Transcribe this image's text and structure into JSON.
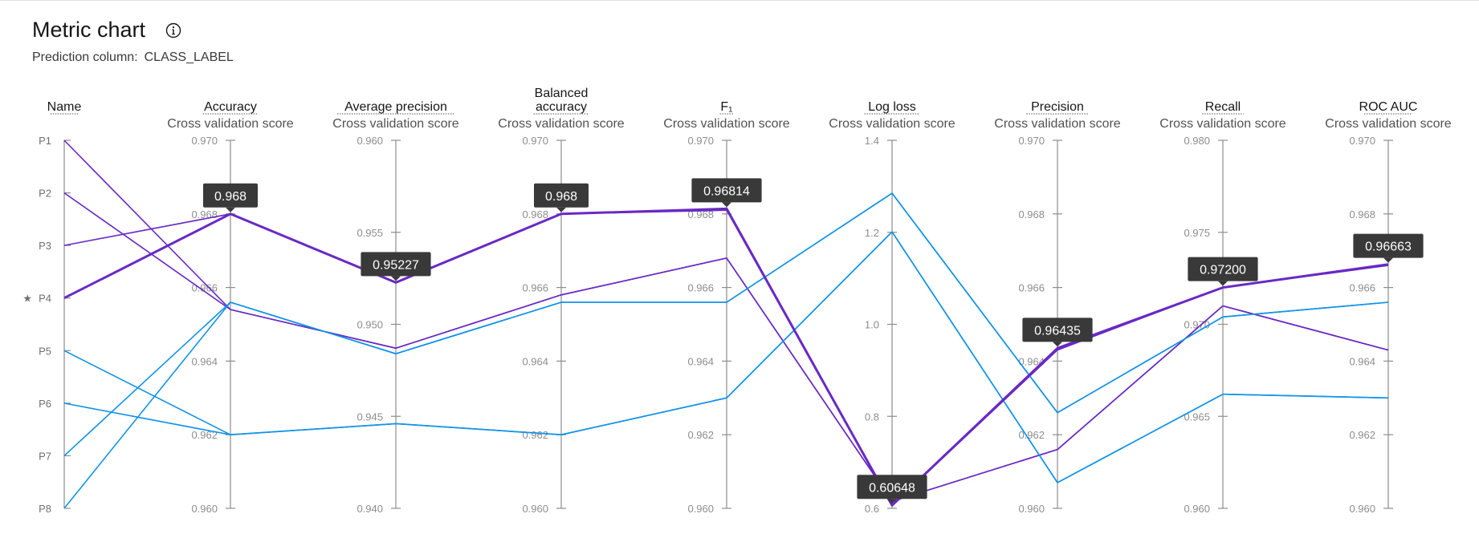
{
  "header": {
    "title": "Metric chart",
    "prediction_label": "Prediction column:",
    "prediction_value": "CLASS_LABEL"
  },
  "colors": {
    "purple": "#6929c4",
    "blue": "#1192e8",
    "axis": "#8d8d8d",
    "tooltip_bg": "#393939"
  },
  "icons": {
    "info": "info-icon"
  },
  "chart_data": {
    "type": "parallel-coordinates",
    "name_axis": {
      "label": "Name",
      "ticks": [
        "P1",
        "P2",
        "P3",
        "P4",
        "P5",
        "P6",
        "P7",
        "P8"
      ],
      "starred": "P4",
      "star_glyph": "★"
    },
    "axes": [
      {
        "key": "accuracy",
        "label": "Accuracy",
        "sublabel": "Cross validation score",
        "range": [
          0.96,
          0.97
        ],
        "ticks": [
          "0.970",
          "0.968",
          "0.966",
          "0.964",
          "0.962",
          "0.960"
        ]
      },
      {
        "key": "avg_precision",
        "label": "Average precision",
        "sublabel": "Cross validation score",
        "range": [
          0.94,
          0.96
        ],
        "ticks": [
          "0.960",
          "0.955",
          "0.950",
          "0.945",
          "0.940"
        ]
      },
      {
        "key": "balanced_accuracy",
        "label": "Balanced",
        "label2": "accuracy",
        "sublabel": "Cross validation score",
        "range": [
          0.96,
          0.97
        ],
        "ticks": [
          "0.970",
          "0.968",
          "0.966",
          "0.964",
          "0.962",
          "0.960"
        ]
      },
      {
        "key": "f1",
        "label": "F₁",
        "sublabel": "Cross validation score",
        "range": [
          0.96,
          0.97
        ],
        "ticks": [
          "0.970",
          "0.968",
          "0.966",
          "0.964",
          "0.962",
          "0.960"
        ]
      },
      {
        "key": "log_loss",
        "label": "Log loss",
        "sublabel": "Cross validation score",
        "range": [
          0.6,
          1.4
        ],
        "ticks": [
          "1.4",
          "1.2",
          "1.0",
          "0.8",
          "0.6"
        ]
      },
      {
        "key": "precision",
        "label": "Precision",
        "sublabel": "Cross validation score",
        "range": [
          0.96,
          0.97
        ],
        "ticks": [
          "0.970",
          "0.968",
          "0.966",
          "0.964",
          "0.962",
          "0.960"
        ]
      },
      {
        "key": "recall",
        "label": "Recall",
        "sublabel": "Cross validation score",
        "range": [
          0.96,
          0.98
        ],
        "ticks": [
          "0.980",
          "0.975",
          "0.970",
          "0.965",
          "0.960"
        ]
      },
      {
        "key": "roc_auc",
        "label": "ROC AUC",
        "sublabel": "Cross validation score",
        "range": [
          0.96,
          0.97
        ],
        "ticks": [
          "0.970",
          "0.968",
          "0.966",
          "0.964",
          "0.962",
          "0.960"
        ]
      }
    ],
    "series": [
      {
        "name": "P1",
        "color": "purple",
        "highlight": false,
        "values": [
          0.9654,
          0.9487,
          0.9658,
          0.9668,
          0.615,
          0.9616,
          0.971,
          0.9643
        ]
      },
      {
        "name": "P2",
        "color": "purple",
        "highlight": false,
        "values": [
          0.9654,
          0.9487,
          0.9658,
          0.9668,
          0.615,
          0.9616,
          0.971,
          0.9643
        ]
      },
      {
        "name": "P3",
        "color": "purple",
        "highlight": false,
        "values": [
          0.968,
          0.9523,
          0.968,
          0.9681,
          0.606,
          0.9643,
          0.972,
          0.9666
        ]
      },
      {
        "name": "P4",
        "color": "purple",
        "highlight": true,
        "values": [
          0.968,
          0.95227,
          0.968,
          0.96814,
          0.60648,
          0.96435,
          0.972,
          0.96663
        ]
      },
      {
        "name": "P5",
        "color": "blue",
        "highlight": false,
        "values": [
          0.962,
          0.9446,
          0.962,
          0.963,
          1.201,
          0.9607,
          0.9662,
          0.963
        ]
      },
      {
        "name": "P6",
        "color": "blue",
        "highlight": false,
        "values": [
          0.962,
          0.9446,
          0.962,
          0.963,
          1.201,
          0.9607,
          0.9662,
          0.963
        ]
      },
      {
        "name": "P7",
        "color": "blue",
        "highlight": false,
        "values": [
          0.9656,
          0.9484,
          0.9656,
          0.9656,
          1.285,
          0.9626,
          0.9704,
          0.9656
        ]
      },
      {
        "name": "P8",
        "color": "blue",
        "highlight": false,
        "values": [
          0.9656,
          0.9484,
          0.9656,
          0.9656,
          1.285,
          0.9626,
          0.9704,
          0.9656
        ]
      }
    ],
    "tooltips": [
      "0.968",
      "0.95227",
      "0.968",
      "0.96814",
      "0.60648",
      "0.96435",
      "0.97200",
      "0.96663"
    ]
  }
}
